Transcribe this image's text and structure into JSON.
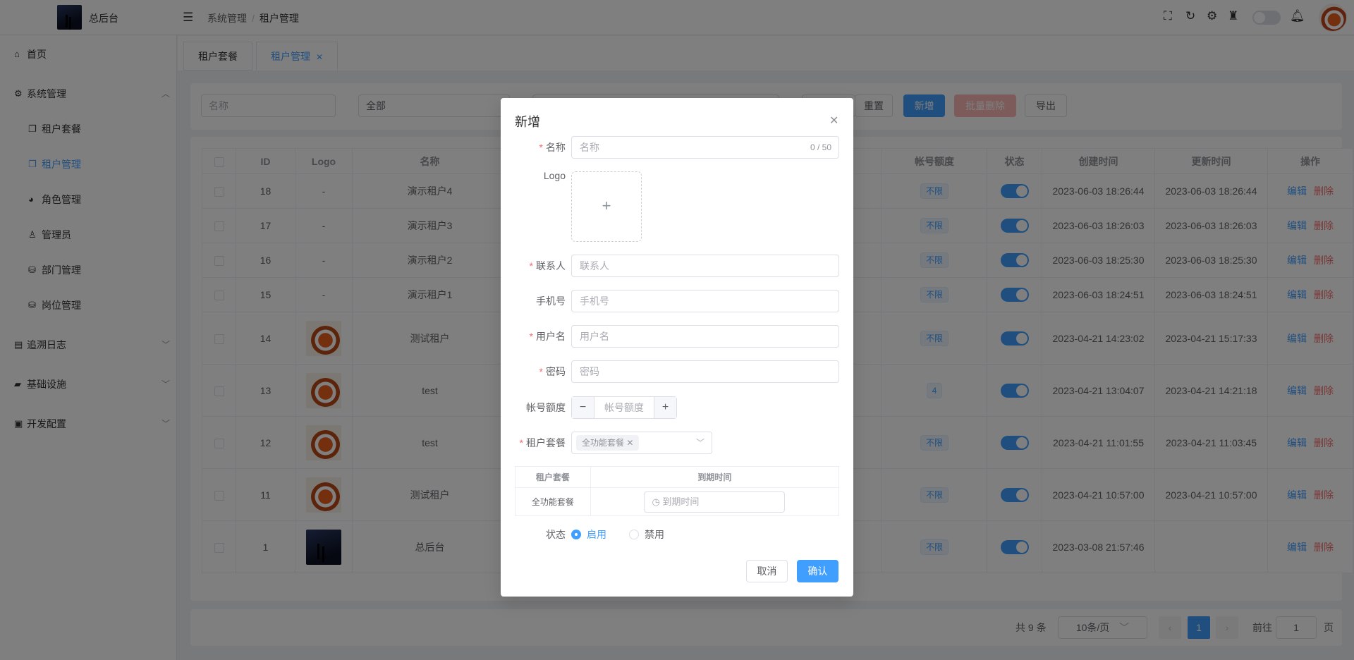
{
  "header": {
    "app_title": "总后台",
    "breadcrumb": [
      "系统管理",
      "租户管理"
    ]
  },
  "sidebar": {
    "items": [
      {
        "label": "首页"
      },
      {
        "label": "系统管理"
      },
      {
        "label": "租户套餐"
      },
      {
        "label": "租户管理"
      },
      {
        "label": "角色管理"
      },
      {
        "label": "管理员"
      },
      {
        "label": "部门管理"
      },
      {
        "label": "岗位管理"
      },
      {
        "label": "追溯日志"
      },
      {
        "label": "基础设施"
      },
      {
        "label": "开发配置"
      }
    ]
  },
  "tabs": [
    {
      "label": "租户套餐"
    },
    {
      "label": "租户管理"
    }
  ],
  "search": {
    "name_placeholder": "名称",
    "status_value": "全部",
    "reset_label": "重置",
    "add_label": "新增",
    "batch_delete_label": "批量删除",
    "export_label": "导出"
  },
  "table": {
    "headers": [
      "ID",
      "Logo",
      "名称",
      "帐号额度",
      "状态",
      "创建时间",
      "更新时间",
      "操作"
    ],
    "rows": [
      {
        "id": "18",
        "logo": "-",
        "name": "演示租户4",
        "quota": "不限",
        "created": "2023-06-03 18:26:44",
        "updated": "2023-06-03 18:26:44"
      },
      {
        "id": "17",
        "logo": "-",
        "name": "演示租户3",
        "quota": "不限",
        "created": "2023-06-03 18:26:03",
        "updated": "2023-06-03 18:26:03"
      },
      {
        "id": "16",
        "logo": "-",
        "name": "演示租户2",
        "quota": "不限",
        "created": "2023-06-03 18:25:30",
        "updated": "2023-06-03 18:25:30"
      },
      {
        "id": "15",
        "logo": "-",
        "name": "演示租户1",
        "quota": "不限",
        "created": "2023-06-03 18:24:51",
        "updated": "2023-06-03 18:24:51"
      },
      {
        "id": "14",
        "logo": "image",
        "name": "测试租户",
        "quota": "不限",
        "created": "2023-04-21 14:23:02",
        "updated": "2023-04-21 15:17:33"
      },
      {
        "id": "13",
        "logo": "image",
        "name": "test",
        "quota": "4",
        "created": "2023-04-21 13:04:07",
        "updated": "2023-04-21 14:21:18"
      },
      {
        "id": "12",
        "logo": "image",
        "name": "test",
        "quota": "不限",
        "created": "2023-04-21 11:01:55",
        "updated": "2023-04-21 11:03:45"
      },
      {
        "id": "11",
        "logo": "image",
        "name": "测试租户",
        "quota": "不限",
        "created": "2023-04-21 10:57:00",
        "updated": "2023-04-21 10:57:00"
      },
      {
        "id": "1",
        "logo": "image",
        "name": "总后台",
        "quota": "不限",
        "created": "2023-03-08 21:57:46",
        "updated": ""
      }
    ],
    "edit_label": "编辑",
    "delete_label": "删除"
  },
  "pagination": {
    "total": "共 9 条",
    "page_size": "10条/页",
    "current_page": "1",
    "goto_label": "前往",
    "goto_value": "1",
    "page_unit": "页"
  },
  "dialog": {
    "title": "新增",
    "name_label": "名称",
    "name_placeholder": "名称",
    "name_count": "0 / 50",
    "logo_label": "Logo",
    "contact_label": "联系人",
    "contact_placeholder": "联系人",
    "phone_label": "手机号",
    "phone_placeholder": "手机号",
    "username_label": "用户名",
    "username_placeholder": "用户名",
    "password_label": "密码",
    "password_placeholder": "密码",
    "quota_label": "帐号额度",
    "quota_placeholder": "帐号额度",
    "package_label": "租户套餐",
    "package_selected": "全功能套餐",
    "package_table_headers": [
      "租户套餐",
      "到期时间"
    ],
    "package_table_row": {
      "package": "全功能套餐",
      "expire_placeholder": "到期时间"
    },
    "status_label": "状态",
    "status_enabled": "启用",
    "status_disabled": "禁用",
    "cancel_label": "取消",
    "confirm_label": "确认"
  },
  "colors": {
    "primary": "#409eff",
    "danger": "#f56c6c"
  }
}
